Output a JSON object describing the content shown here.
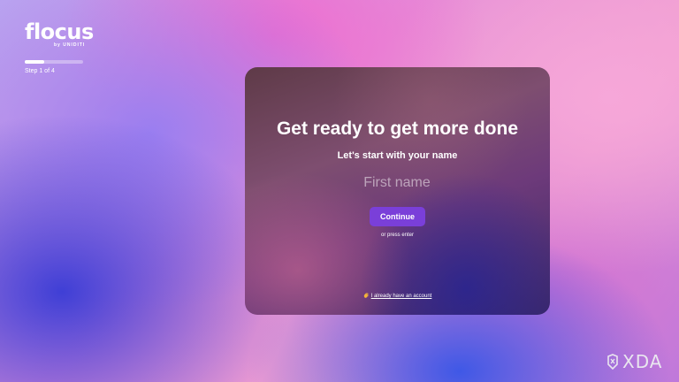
{
  "brand": {
    "name": "flocus",
    "byline": "by UNIDITI"
  },
  "progress": {
    "fraction": 0.33,
    "step_label": "Step 1 of 4"
  },
  "card": {
    "headline": "Get ready to get more done",
    "subheadline": "Let's start with your name",
    "name_input": {
      "placeholder": "First name",
      "value": ""
    },
    "continue_label": "Continue",
    "press_enter_hint": "or press enter",
    "account_link_label": "I already have an account",
    "account_link_icon": "waving-hand-icon"
  },
  "watermark": {
    "text": "XDA",
    "icon": "xda-logo-icon"
  },
  "colors": {
    "accent_button": "#7a3fd9",
    "text_primary": "#ffffff"
  }
}
